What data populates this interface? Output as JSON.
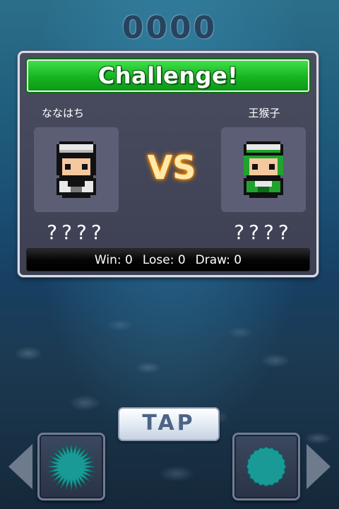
{
  "header": {
    "counter": "0000"
  },
  "dialog": {
    "title": "Challenge!",
    "vs_label": "VS",
    "player1": {
      "name": "ななはち",
      "score": "????"
    },
    "player2": {
      "name": "王猴子",
      "score": "????"
    },
    "stats": {
      "win": "Win: 0",
      "lose": "Lose: 0",
      "draw": "Draw: 0"
    }
  },
  "controls": {
    "tap_label": "TAP",
    "left_button_icon": "spiky-ball-icon",
    "right_button_icon": "round-ball-icon",
    "left_arrow_icon": "arrow-left-icon",
    "right_arrow_icon": "arrow-right-icon"
  },
  "colors": {
    "banner_green": "#17b421",
    "vs_glow": "#ff9a00",
    "ball_teal": "#1a9a96",
    "player1_cap": "#e8e8e8",
    "player2_cap": "#1fa32e"
  }
}
